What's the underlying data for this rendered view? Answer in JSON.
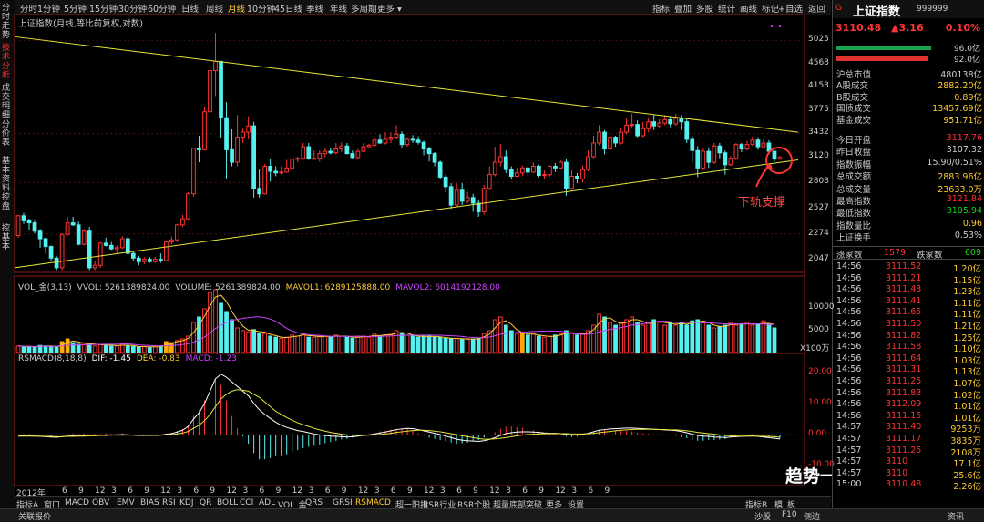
{
  "topbar": [
    "分时",
    "1分钟",
    "5分钟",
    "15分钟",
    "30分钟",
    "60分钟",
    "日线",
    "周线",
    "月线",
    "10分钟",
    "45日线",
    "季线",
    "年线",
    "多周期",
    "更多 ▾",
    "指标",
    "叠加",
    "多股",
    "统计",
    "画线",
    "标记",
    "+自选",
    "返回"
  ],
  "leftnav": [
    "分时走势",
    "技术分析",
    "成交明细",
    "分价表",
    "基本资料",
    "控盘",
    "控基本"
  ],
  "chart_title": "上证指数(月线,等比前复权,对数)",
  "y_ticks": [
    "5025",
    "4568",
    "4153",
    "3775",
    "3432",
    "3120",
    "2808",
    "2527",
    "2274",
    "2047"
  ],
  "vol_label": {
    "a": "VOL_金(3,13)",
    "b": "VVOL: 5261389824.00",
    "c": "VOLUME: 5261389824.00",
    "d": "MAVOL1: 6289125888.00",
    "e": "MAVOL2: 6014192128.00"
  },
  "vol_ticks": [
    "10000",
    "5000",
    "X100万"
  ],
  "macd_label": {
    "a": "RSMACD(8,18,8)",
    "b": "DIF: -1.45",
    "c": "DEA: -0.83",
    "d": "MACD: -1.23"
  },
  "macd_ticks": [
    "20.00",
    "10.00",
    "0.00",
    "-10.00"
  ],
  "x_axis": [
    "2012年",
    "6",
    "9",
    "12",
    "3",
    "6",
    "9",
    "12",
    "3",
    "6",
    "9",
    "12",
    "3",
    "6",
    "9",
    "12",
    "3",
    "6",
    "9",
    "12",
    "3",
    "6",
    "9",
    "12",
    "3",
    "6",
    "9",
    "12",
    "3",
    "6",
    "9",
    "12",
    "3",
    "6",
    "9"
  ],
  "annotation": "下轨支撑",
  "watermark": "趋势一阳指",
  "bottomtabs": [
    "指标A",
    "窗口",
    "MACD",
    "OBV",
    "EMV",
    "BIAS",
    "RSI",
    "KDJ",
    "QR",
    "BOLL",
    "CCI",
    "ADL",
    "VOL_金",
    "QRS",
    "GRSI",
    "RSMACD",
    "超一阳指",
    "RSR行业",
    "RSR个股",
    "超量底部突破",
    "更多",
    "设置",
    "指标B",
    "模",
    "板"
  ],
  "statusbar": [
    "关联报价",
    "沙股",
    "F10",
    "侧边",
    "资讯"
  ],
  "rp": {
    "name": "上证指数",
    "code": "999999",
    "price": "3110.48",
    "chg": "▲3.16",
    "pct": "0.10%",
    "bar1": "96.0亿",
    "bar2": "92.0亿",
    "rows1": [
      [
        "沪总市值",
        "480138亿"
      ],
      [
        "A股成交",
        "2882.20亿"
      ],
      [
        "B股成交",
        "0.89亿"
      ],
      [
        "国债成交",
        "13457.69亿"
      ],
      [
        "基金成交",
        "951.71亿"
      ]
    ],
    "rows2": [
      [
        "今日开盘",
        "3117.76"
      ],
      [
        "昨日收盘",
        "3107.32"
      ],
      [
        "指数振幅",
        "15.90/0.51%"
      ],
      [
        "总成交额",
        "2883.96亿"
      ],
      [
        "总成交量",
        "23633.0万"
      ],
      [
        "最高指数",
        "3121.84"
      ],
      [
        "最低指数",
        "3105.94"
      ],
      [
        "指数量比",
        "0.96"
      ],
      [
        "上证换手",
        "0.53%"
      ]
    ],
    "updown": {
      "k1": "涨家数",
      "v1": "1579",
      "k2": "跌家数",
      "v2": "609"
    },
    "ticks": [
      [
        "14:56",
        "3111.52",
        "1.20亿"
      ],
      [
        "14:56",
        "3111.21",
        "1.15亿"
      ],
      [
        "14:56",
        "3111.43",
        "1.23亿"
      ],
      [
        "14:56",
        "3111.41",
        "1.11亿"
      ],
      [
        "14:56",
        "3111.65",
        "1.11亿"
      ],
      [
        "14:56",
        "3111.50",
        "1.21亿"
      ],
      [
        "14:56",
        "3111.82",
        "1.25亿"
      ],
      [
        "14:56",
        "3111.58",
        "1.10亿"
      ],
      [
        "14:56",
        "3111.64",
        "1.03亿"
      ],
      [
        "14:56",
        "3111.31",
        "1.13亿"
      ],
      [
        "14:56",
        "3111.25",
        "1.07亿"
      ],
      [
        "14:56",
        "3111.83",
        "1.02亿"
      ],
      [
        "14:56",
        "3112.09",
        "1.01亿"
      ],
      [
        "14:56",
        "3111.15",
        "1.01亿"
      ],
      [
        "14:57",
        "3111.40",
        "9253万"
      ],
      [
        "14:57",
        "3111.17",
        "3835万"
      ],
      [
        "14:57",
        "3111.25",
        "2108万"
      ],
      [
        "14:57",
        "3110",
        "17.1亿"
      ],
      [
        "14:57",
        "3110",
        "25.6亿"
      ],
      [
        "15:00",
        "3110.48",
        "2.26亿"
      ]
    ]
  },
  "chart_data": {
    "type": "candlestick",
    "title": "上证指数(月线,等比前复权,对数)",
    "ylim": [
      1950,
      5300
    ],
    "candles": [
      [
        2260,
        2450,
        2460,
        2240
      ],
      [
        2450,
        2400,
        2480,
        2370
      ],
      [
        2400,
        2380,
        2420,
        2310
      ],
      [
        2380,
        2300,
        2400,
        2280
      ],
      [
        2300,
        2230,
        2320,
        2150
      ],
      [
        2230,
        2160,
        2240,
        2100
      ],
      [
        2160,
        2060,
        2170,
        2040
      ],
      [
        2060,
        1980,
        2080,
        1960
      ],
      [
        1980,
        2270,
        2280,
        1960
      ],
      [
        2270,
        2380,
        2440,
        2260
      ],
      [
        2380,
        2360,
        2440,
        2350
      ],
      [
        2360,
        2180,
        2390,
        2170
      ],
      [
        2180,
        2300,
        2320,
        2170
      ],
      [
        2300,
        1980,
        2340,
        1960
      ],
      [
        1980,
        2000,
        2040,
        1960
      ],
      [
        2000,
        2190,
        2200,
        1980
      ],
      [
        2190,
        2170,
        2240,
        2160
      ],
      [
        2170,
        2140,
        2200,
        2130
      ],
      [
        2140,
        2150,
        2170,
        2100
      ],
      [
        2150,
        2230,
        2250,
        2140
      ],
      [
        2230,
        2100,
        2250,
        2090
      ],
      [
        2100,
        2060,
        2120,
        2040
      ],
      [
        2060,
        2030,
        2080,
        2000
      ],
      [
        2030,
        2050,
        2070,
        2010
      ],
      [
        2050,
        2030,
        2070,
        2020
      ],
      [
        2030,
        2050,
        2070,
        2020
      ],
      [
        2050,
        2040,
        2100,
        2020
      ],
      [
        2040,
        2200,
        2210,
        2040
      ],
      [
        2200,
        2220,
        2250,
        2180
      ],
      [
        2220,
        2360,
        2370,
        2200
      ],
      [
        2360,
        2420,
        2460,
        2340
      ],
      [
        2420,
        2680,
        2700,
        2400
      ],
      [
        2680,
        3230,
        3240,
        2650
      ],
      [
        3230,
        3210,
        3400,
        3050
      ],
      [
        3210,
        3750,
        3830,
        3200
      ],
      [
        3750,
        4440,
        4500,
        3700
      ],
      [
        4440,
        4610,
        5180,
        4000
      ],
      [
        4610,
        3660,
        4500,
        3370
      ],
      [
        3660,
        3210,
        3900,
        2850
      ],
      [
        3210,
        3050,
        3490,
        3000
      ],
      [
        3050,
        3380,
        3700,
        3000
      ],
      [
        3380,
        3450,
        3500,
        3300
      ],
      [
        3450,
        3540,
        3680,
        3350
      ],
      [
        3540,
        2740,
        3600,
        2640
      ],
      [
        2740,
        2680,
        2960,
        2640
      ],
      [
        2680,
        3000,
        3030,
        2680
      ],
      [
        3000,
        2940,
        3090,
        2820
      ],
      [
        2940,
        2920,
        3000,
        2880
      ],
      [
        2920,
        2930,
        3000,
        2900
      ],
      [
        2930,
        2980,
        3080,
        2920
      ],
      [
        2980,
        3090,
        3110,
        2970
      ],
      [
        3090,
        3100,
        3120,
        3050
      ],
      [
        3100,
        3250,
        3300,
        3080
      ],
      [
        3250,
        3100,
        3300,
        3080
      ],
      [
        3100,
        3100,
        3200,
        3080
      ],
      [
        3100,
        3160,
        3200,
        3060
      ],
      [
        3160,
        3190,
        3230,
        3110
      ],
      [
        3190,
        3170,
        3240,
        3150
      ],
      [
        3170,
        3220,
        3300,
        3150
      ],
      [
        3220,
        3260,
        3310,
        3180
      ],
      [
        3260,
        3160,
        3300,
        3150
      ],
      [
        3160,
        3110,
        3200,
        3100
      ],
      [
        3110,
        3190,
        3220,
        3090
      ],
      [
        3190,
        3250,
        3300,
        3180
      ],
      [
        3250,
        3270,
        3290,
        3230
      ],
      [
        3270,
        3340,
        3380,
        3250
      ],
      [
        3340,
        3300,
        3420,
        3290
      ],
      [
        3300,
        3350,
        3450,
        3280
      ],
      [
        3350,
        3380,
        3450,
        3300
      ],
      [
        3380,
        3420,
        3550,
        3350
      ],
      [
        3420,
        3280,
        3460,
        3240
      ],
      [
        3280,
        3350,
        3380,
        3250
      ],
      [
        3350,
        3340,
        3410,
        3300
      ],
      [
        3340,
        3310,
        3390,
        3280
      ],
      [
        3310,
        3220,
        3330,
        3140
      ],
      [
        3220,
        3160,
        3250,
        3060
      ],
      [
        3160,
        3050,
        3180,
        3000
      ],
      [
        3050,
        2870,
        3070,
        2850
      ],
      [
        2870,
        2760,
        2900,
        2700
      ],
      [
        2760,
        2560,
        2800,
        2520
      ],
      [
        2560,
        2720,
        2800,
        2540
      ],
      [
        2720,
        2600,
        2800,
        2560
      ],
      [
        2600,
        2640,
        2700,
        2580
      ],
      [
        2640,
        2580,
        2680,
        2490
      ],
      [
        2580,
        2490,
        2620,
        2440
      ],
      [
        2490,
        2740,
        2780,
        2460
      ],
      [
        2740,
        2900,
        3000,
        2720
      ],
      [
        2900,
        3050,
        3250,
        2880
      ],
      [
        3050,
        3120,
        3290,
        3000
      ],
      [
        3120,
        2960,
        3200,
        2920
      ],
      [
        2960,
        2880,
        3000,
        2850
      ],
      [
        2880,
        2920,
        2980,
        2870
      ],
      [
        2920,
        2980,
        3010,
        2880
      ],
      [
        2980,
        2930,
        3000,
        2890
      ],
      [
        2930,
        3000,
        3050,
        2920
      ],
      [
        3000,
        2890,
        3020,
        2870
      ],
      [
        2890,
        2900,
        2950,
        2850
      ],
      [
        2900,
        3000,
        3010,
        2880
      ],
      [
        3000,
        2980,
        3040,
        2930
      ],
      [
        2980,
        3050,
        3070,
        2960
      ],
      [
        3050,
        2740,
        3090,
        2660
      ],
      [
        2740,
        2880,
        2950,
        2720
      ],
      [
        2880,
        2850,
        2920,
        2800
      ],
      [
        2850,
        2960,
        3010,
        2810
      ],
      [
        2960,
        3120,
        3200,
        2940
      ],
      [
        3120,
        3300,
        3400,
        3100
      ],
      [
        3300,
        3450,
        3550,
        3270
      ],
      [
        3450,
        3220,
        3480,
        3150
      ],
      [
        3220,
        3380,
        3450,
        3200
      ],
      [
        3380,
        3300,
        3400,
        3250
      ],
      [
        3300,
        3450,
        3500,
        3280
      ],
      [
        3450,
        3550,
        3650,
        3420
      ],
      [
        3550,
        3560,
        3720,
        3500
      ],
      [
        3560,
        3400,
        3620,
        3380
      ],
      [
        3400,
        3500,
        3600,
        3380
      ],
      [
        3500,
        3600,
        3650,
        3450
      ],
      [
        3600,
        3540,
        3700,
        3480
      ],
      [
        3540,
        3580,
        3640,
        3500
      ],
      [
        3580,
        3630,
        3700,
        3550
      ],
      [
        3630,
        3570,
        3680,
        3520
      ],
      [
        3570,
        3650,
        3720,
        3540
      ],
      [
        3650,
        3600,
        3700,
        3480
      ],
      [
        3600,
        3350,
        3640,
        3300
      ],
      [
        3350,
        3200,
        3400,
        3050
      ],
      [
        3200,
        2980,
        3260,
        2870
      ],
      [
        2980,
        3190,
        3230,
        2950
      ],
      [
        3190,
        3050,
        3240,
        2980
      ],
      [
        3050,
        3260,
        3300,
        3030
      ],
      [
        3260,
        3170,
        3300,
        3100
      ],
      [
        3170,
        3020,
        3200,
        2900
      ],
      [
        3020,
        3100,
        3130,
        3000
      ],
      [
        3100,
        3280,
        3300,
        3080
      ],
      [
        3280,
        3220,
        3300,
        3180
      ],
      [
        3220,
        3280,
        3330,
        3200
      ],
      [
        3280,
        3340,
        3390,
        3260
      ],
      [
        3340,
        3250,
        3380,
        3210
      ],
      [
        3250,
        3300,
        3350,
        3220
      ],
      [
        3300,
        3190,
        3340,
        3150
      ],
      [
        3190,
        3090,
        3200,
        3060
      ],
      [
        3090,
        3110,
        3130,
        3080
      ]
    ],
    "volume": [
      1200,
      1100,
      1100,
      1000,
      1300,
      1200,
      1100,
      1000,
      2000,
      2500,
      1800,
      1500,
      1800,
      1600,
      1200,
      1500,
      1400,
      1200,
      1200,
      1600,
      1200,
      1100,
      1000,
      1100,
      1000,
      1000,
      1200,
      2000,
      1800,
      2200,
      2500,
      3000,
      5500,
      6500,
      8000,
      11000,
      11500,
      9000,
      7500,
      6000,
      4500,
      4000,
      3800,
      4200,
      3500,
      3500,
      3000,
      2800,
      2600,
      2800,
      3200,
      3000,
      3500,
      2800,
      2800,
      3000,
      3000,
      2800,
      3200,
      3000,
      2800,
      2600,
      3000,
      3000,
      2800,
      3500,
      3000,
      3200,
      3500,
      4000,
      3500,
      3200,
      3000,
      2800,
      3000,
      3000,
      2800,
      2800,
      2600,
      2500,
      2600,
      2500,
      2400,
      2500,
      2600,
      3500,
      4000,
      6000,
      6500,
      5000,
      4000,
      3500,
      3500,
      3200,
      3400,
      3000,
      2800,
      3000,
      3200,
      3400,
      4000,
      3500,
      3200,
      3500,
      4000,
      5000,
      7000,
      6500,
      5500,
      5000,
      5500,
      6000,
      6500,
      5500,
      5000,
      5500,
      6000,
      5500,
      5000,
      5500,
      5000,
      5500,
      5000,
      5800,
      6000,
      5500,
      5000,
      4500,
      4800,
      5000,
      5500,
      5000,
      5200,
      5500,
      5000,
      5200,
      5800,
      5000,
      4500
    ],
    "yellow_vol": [
      8,
      9,
      27,
      28,
      92
    ],
    "upper_trendline": [
      [
        0,
        5100
      ],
      [
        140,
        3450
      ]
    ],
    "lower_trendline": [
      [
        0,
        1980
      ],
      [
        140,
        3080
      ]
    ],
    "dif": [
      -0.5,
      -0.4,
      -0.4,
      -0.5,
      -0.6,
      -0.7,
      -0.8,
      -0.9,
      -0.7,
      -0.5,
      -0.4,
      -0.4,
      -0.3,
      -0.4,
      -0.3,
      -0.2,
      -0.1,
      -0.1,
      -0.1,
      0,
      -0.1,
      -0.2,
      -0.3,
      -0.3,
      -0.3,
      -0.3,
      -0.2,
      0.1,
      0.3,
      0.8,
      1.4,
      2.6,
      5,
      7,
      10,
      14,
      18,
      19.5,
      18.5,
      17,
      15.5,
      14,
      12.5,
      10,
      8,
      6.5,
      5.2,
      4,
      3,
      2.3,
      1.8,
      1.3,
      1,
      0.6,
      0.2,
      -0.1,
      -0.3,
      -0.5,
      -0.6,
      -0.7,
      -0.8,
      -0.7,
      -0.5,
      -0.3,
      -0.1,
      0.2,
      0.5,
      0.8,
      1.2,
      1.6,
      1.8,
      2,
      1.9,
      1.6,
      1.2,
      0.8,
      0.4,
      0,
      -0.5,
      -1,
      -1.5,
      -1.8,
      -2,
      -2.1,
      -2.2,
      -2,
      -1.6,
      -1,
      -0.3,
      0.3,
      0.6,
      0.8,
      0.9,
      0.9,
      0.8,
      0.7,
      0.5,
      0.4,
      0.4,
      0.3,
      0,
      -0.2,
      -0.1,
      0.1,
      0.4,
      0.9,
      1.4,
      1.6,
      1.8,
      1.9,
      2,
      2.1,
      2.1,
      2,
      1.9,
      1.8,
      1.7,
      1.6,
      1.5,
      1.4,
      1.3,
      1,
      0.6,
      0.1,
      -0.3,
      -0.5,
      -0.6,
      -0.8,
      -0.9,
      -1,
      -0.8,
      -0.7,
      -0.6,
      -0.5,
      -0.4,
      -0.6,
      -0.8,
      -1,
      -1.2,
      -1.45
    ],
    "dea": [
      -0.5,
      -0.5,
      -0.5,
      -0.5,
      -0.5,
      -0.6,
      -0.6,
      -0.7,
      -0.7,
      -0.6,
      -0.6,
      -0.5,
      -0.5,
      -0.4,
      -0.4,
      -0.3,
      -0.3,
      -0.2,
      -0.2,
      -0.2,
      -0.2,
      -0.2,
      -0.2,
      -0.2,
      -0.3,
      -0.3,
      -0.2,
      -0.1,
      0,
      0.2,
      0.5,
      1,
      2,
      3,
      4.5,
      6.5,
      9,
      11.5,
      13,
      14,
      14.5,
      14.3,
      14,
      13,
      12,
      10.5,
      9,
      7.5,
      6.5,
      5.5,
      4.6,
      3.8,
      3.2,
      2.6,
      2,
      1.5,
      1.1,
      0.7,
      0.4,
      0.1,
      -0.1,
      -0.2,
      -0.3,
      -0.3,
      -0.2,
      -0.1,
      0,
      0.2,
      0.4,
      0.7,
      0.9,
      1.1,
      1.3,
      1.4,
      1.4,
      1.3,
      1.1,
      0.9,
      0.6,
      0.3,
      0,
      -0.4,
      -0.7,
      -1,
      -1.3,
      -1.5,
      -1.5,
      -1.4,
      -1.2,
      -1,
      -0.7,
      -0.4,
      -0.2,
      0,
      0.1,
      0.2,
      0.3,
      0.3,
      0.3,
      0.3,
      0.3,
      0.2,
      0.2,
      0.2,
      0.3,
      0.4,
      0.6,
      0.8,
      1,
      1.2,
      1.4,
      1.5,
      1.6,
      1.7,
      1.7,
      1.7,
      1.7,
      1.6,
      1.6,
      1.5,
      1.5,
      1.4,
      1.2,
      1,
      0.7,
      0.5,
      0.3,
      0.1,
      -0.1,
      -0.3,
      -0.4,
      -0.5,
      -0.5,
      -0.5,
      -0.5,
      -0.5,
      -0.6,
      -0.6,
      -0.7,
      -0.83
    ]
  }
}
